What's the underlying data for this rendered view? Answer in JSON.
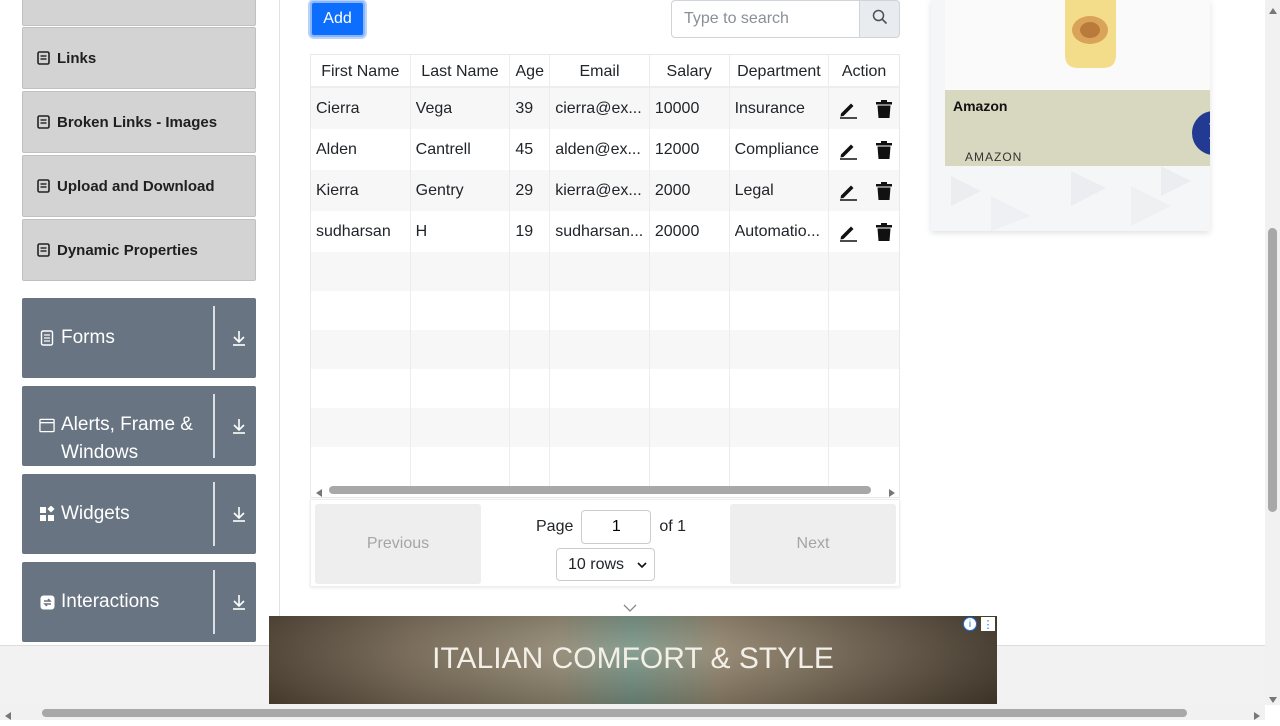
{
  "sidebar": {
    "sub_items": [
      {
        "label": "Links"
      },
      {
        "label": "Broken Links - Images"
      },
      {
        "label": "Upload and Download"
      },
      {
        "label": "Dynamic Properties"
      }
    ],
    "groups": [
      {
        "label": "Forms",
        "icon": "document-icon"
      },
      {
        "label": "Alerts, Frame & Windows",
        "icon": "window-icon"
      },
      {
        "label": "Widgets",
        "icon": "widgets-icon"
      },
      {
        "label": "Interactions",
        "icon": "interactions-icon"
      }
    ]
  },
  "toolbar": {
    "add_label": "Add",
    "search_placeholder": "Type to search"
  },
  "table": {
    "columns": [
      "First Name",
      "Last Name",
      "Age",
      "Email",
      "Salary",
      "Department",
      "Action"
    ],
    "rows": [
      {
        "first": "Cierra",
        "last": "Vega",
        "age": "39",
        "email": "cierra@ex...",
        "salary": "10000",
        "department": "Insurance"
      },
      {
        "first": "Alden",
        "last": "Cantrell",
        "age": "45",
        "email": "alden@ex...",
        "salary": "12000",
        "department": "Compliance"
      },
      {
        "first": "Kierra",
        "last": "Gentry",
        "age": "29",
        "email": "kierra@ex...",
        "salary": "2000",
        "department": "Legal"
      },
      {
        "first": "sudharsan",
        "last": "H",
        "age": "19",
        "email": "sudharsan...",
        "salary": "20000",
        "department": "Automatio..."
      }
    ]
  },
  "pagination": {
    "previous_label": "Previous",
    "next_label": "Next",
    "page_label": "Page",
    "page_value": "1",
    "of_label": "of 1",
    "rows_label": "10 rows"
  },
  "side_ad": {
    "title": "Amazon",
    "brand": "AMAZON"
  },
  "bottom_ad": {
    "text": "ITALIAN COMFORT & STYLE"
  },
  "colors": {
    "primary": "#0d6efd",
    "sidebar_group": "#687482",
    "sidebar_sub": "#d3d3d3",
    "ad_button": "#233a93"
  }
}
